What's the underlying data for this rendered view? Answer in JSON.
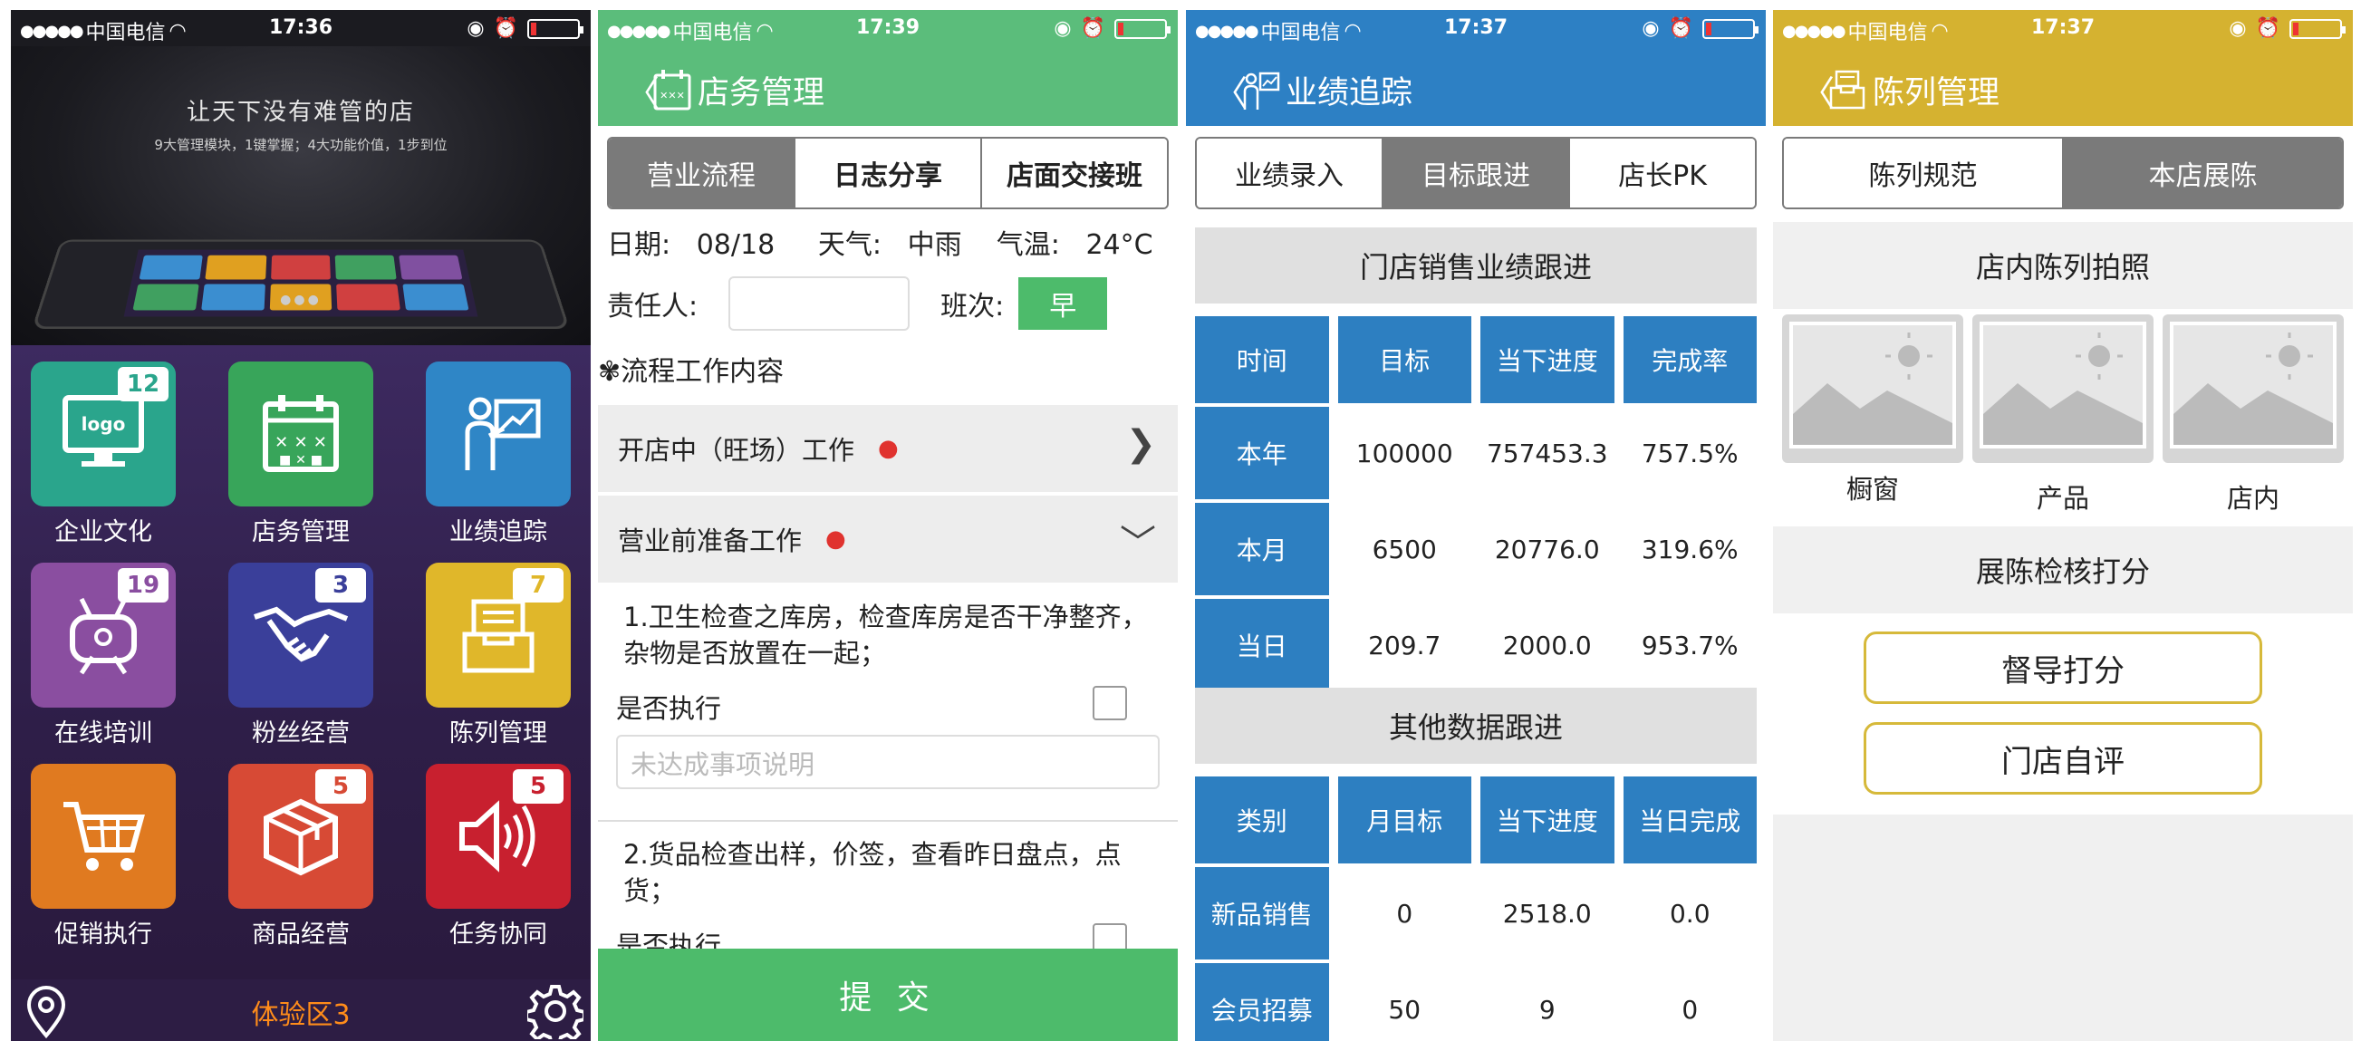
{
  "status_bars": [
    {
      "carrier": "中国电信",
      "time": "17:36"
    },
    {
      "carrier": "中国电信",
      "time": "17:39"
    },
    {
      "carrier": "中国电信",
      "time": "17:37"
    },
    {
      "carrier": "中国电信",
      "time": "17:37"
    }
  ],
  "colors": {
    "green": "#5bbd7b",
    "blue": "#2d80c4",
    "yellow": "#d5b230",
    "purple_bg": "#2d1d44",
    "accent_orange": "#ff8c1a"
  },
  "home": {
    "banner_title": "让天下没有难管的店",
    "banner_subtitle": "9大管理模块，1键掌握；4大功能价值，1步到位",
    "pager": "●●●",
    "tiles": [
      {
        "label": "企业文化",
        "badge": "12",
        "icon": "logo-monitor-icon",
        "color": "#2aa58c"
      },
      {
        "label": "店务管理",
        "badge": "",
        "icon": "calendar-icon",
        "color": "#38a55a"
      },
      {
        "label": "业绩追踪",
        "badge": "",
        "icon": "presenter-chart-icon",
        "color": "#2f86c6"
      },
      {
        "label": "在线培训",
        "badge": "19",
        "icon": "tv-person-icon",
        "color": "#8a4ea0"
      },
      {
        "label": "粉丝经营",
        "badge": "3",
        "icon": "handshake-icon",
        "color": "#3a3f9a"
      },
      {
        "label": "陈列管理",
        "badge": "7",
        "icon": "file-tray-icon",
        "color": "#e0b72a"
      },
      {
        "label": "促销执行",
        "badge": "",
        "icon": "cart-icon",
        "color": "#e07a20"
      },
      {
        "label": "商品经营",
        "badge": "5",
        "icon": "box-icon",
        "color": "#d74a35"
      },
      {
        "label": "任务协同",
        "badge": "5",
        "icon": "speaker-icon",
        "color": "#c8202f"
      }
    ],
    "zone_label": "体验区3"
  },
  "store": {
    "title": "店务管理",
    "tabs": [
      "营业流程",
      "日志分享",
      "店面交接班"
    ],
    "active_tab": 0,
    "date_label": "日期:",
    "date": "08/18",
    "weather_label": "天气:",
    "weather": "中雨",
    "temp_label": "气温:",
    "temp": "24°C",
    "responsible_label": "责任人:",
    "shift_label": "班次:",
    "shift": "早",
    "process_title": "✾流程工作内容",
    "sections": [
      {
        "title": "开店中（旺场）工作",
        "arrow": "❯"
      },
      {
        "title": "营业前准备工作",
        "arrow": "﹀"
      }
    ],
    "tasks": [
      {
        "text": "1.卫生检查之库房，检查库房是否干净整齐，杂物是否放置在一起；"
      },
      {
        "text": "2.货品检查出样，价签，查看昨日盘点，点货；"
      }
    ],
    "exec_label": "是否执行",
    "note_placeholder": "未达成事项说明",
    "submit": "提 交"
  },
  "perf": {
    "title": "业绩追踪",
    "tabs": [
      "业绩录入",
      "目标跟进",
      "店长PK"
    ],
    "active_tab": 1,
    "section1": "门店销售业绩跟进",
    "table1": {
      "headers": [
        "时间",
        "目标",
        "当下进度",
        "完成率"
      ],
      "rows": [
        [
          "本年",
          "100000",
          "757453.3",
          "757.5%"
        ],
        [
          "本月",
          "6500",
          "20776.0",
          "319.6%"
        ],
        [
          "当日",
          "209.7",
          "2000.0",
          "953.7%"
        ]
      ]
    },
    "section2": "其他数据跟进",
    "table2": {
      "headers": [
        "类别",
        "月目标",
        "当下进度",
        "当日完成"
      ],
      "rows": [
        [
          "新品销售",
          "0",
          "2518.0",
          "0.0"
        ],
        [
          "会员招募",
          "50",
          "9",
          "0"
        ]
      ]
    }
  },
  "display": {
    "title": "陈列管理",
    "tabs": [
      "陈列规范",
      "本店展陈"
    ],
    "active_tab": 1,
    "photo_section": "店内陈列拍照",
    "photos": [
      "橱窗",
      "产品",
      "店内"
    ],
    "score_section": "展陈检核打分",
    "buttons": [
      "督导打分",
      "门店自评"
    ]
  }
}
